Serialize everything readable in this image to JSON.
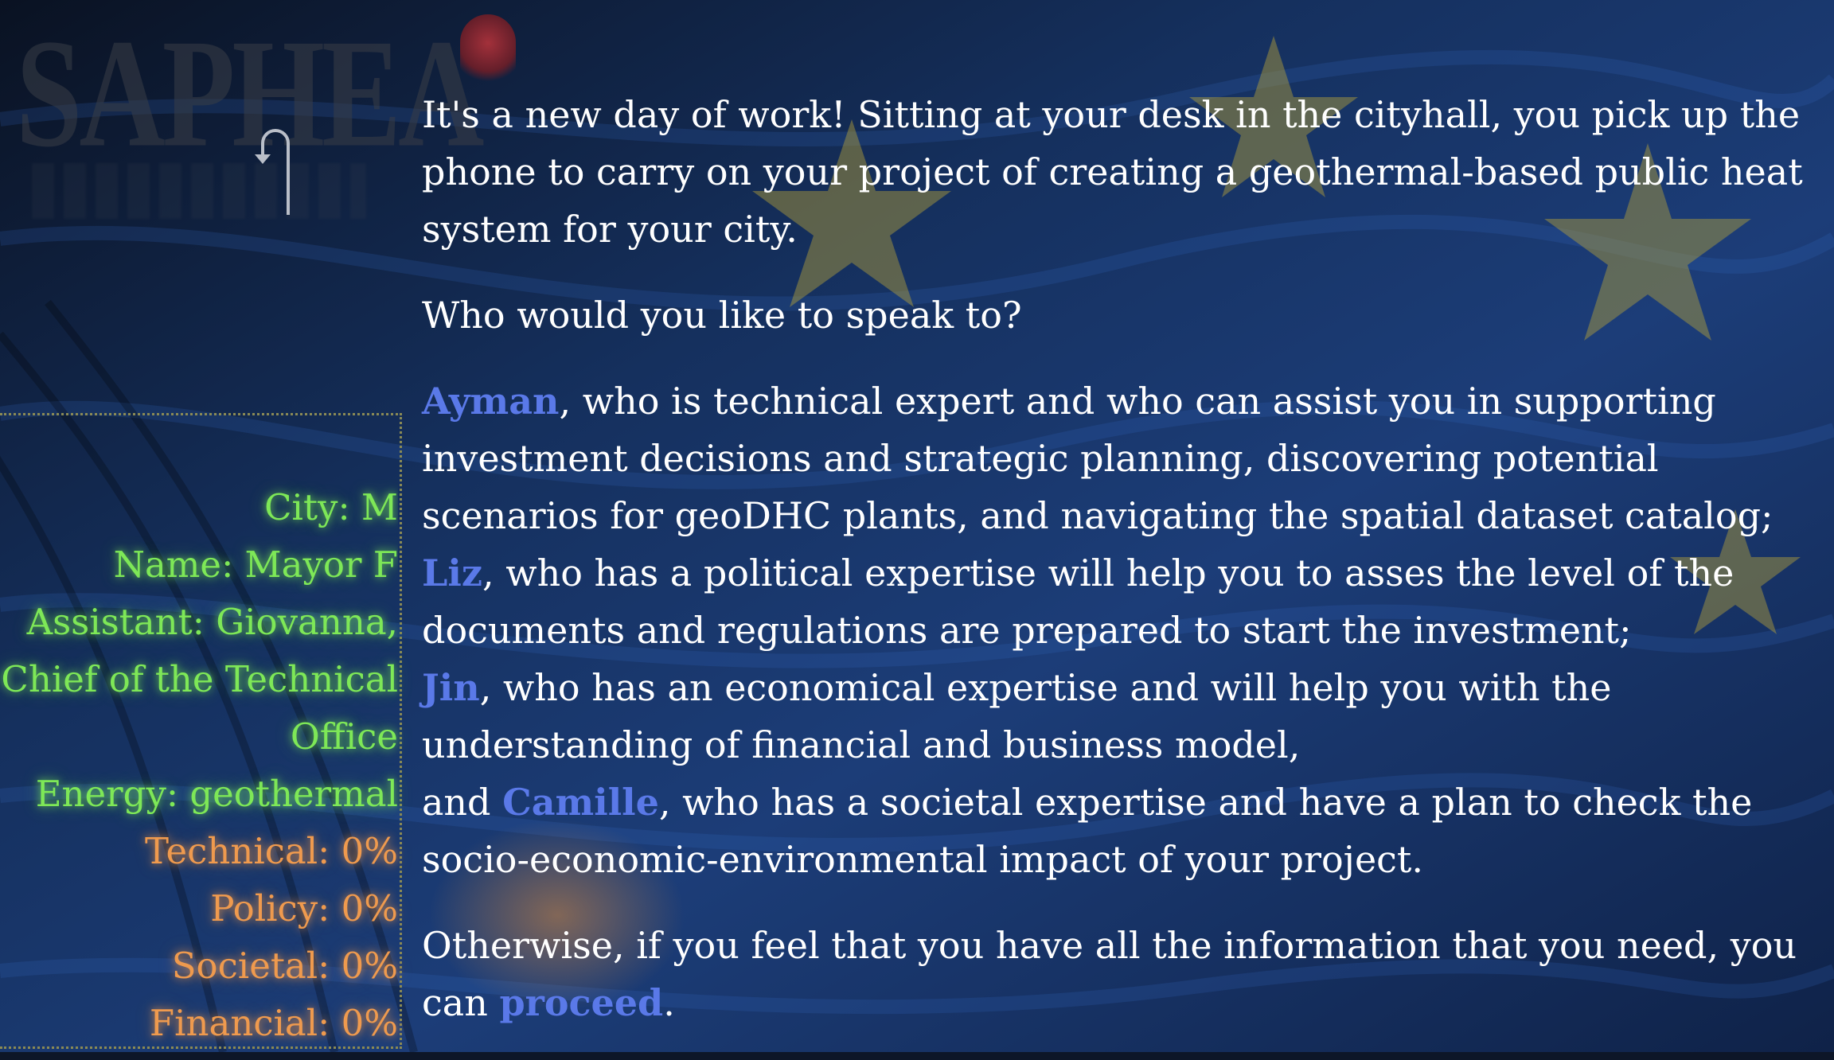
{
  "logo": {
    "text": "SAPHEA"
  },
  "profile": {
    "city": "City: M",
    "name": "Name: Mayor F",
    "assistant": "Assistant: Giovanna, Chief of the Technical Office",
    "energy": "Energy: geothermal",
    "technical": "Technical: 0%",
    "policy": "Policy: 0%",
    "societal": "Societal: 0%",
    "financial": "Financial: 0%"
  },
  "story": {
    "intro": "It's a new day of work! Sitting at your desk in the cityhall, you pick up the phone to carry on your project of creating a geothermal-based public heat system for your city.",
    "question": "Who would you like to speak to?",
    "ayman": {
      "link": "Ayman",
      "text": ", who is technical expert and who can assist you in supporting investment decisions and strategic planning, discovering potential scenarios for geoDHC plants, and navigating the spatial dataset catalog;"
    },
    "liz": {
      "link": "Liz",
      "text": ", who has a political expertise will help you to asses the level of the documents and regulations are prepared to start the investment;"
    },
    "jin": {
      "link": "Jin",
      "text": ", who has an economical expertise and will help you with the understanding of financial and business model,"
    },
    "camille": {
      "prefix": "and ",
      "link": "Camille",
      "text": ", who has a societal expertise and have a plan to check the socio-economic-environmental impact of your project."
    },
    "otherwise": {
      "text": "Otherwise, if you feel that you have all the information that you need, you can ",
      "link": "proceed",
      "suffix": "."
    }
  },
  "colors": {
    "link": "#5a79e8",
    "stat_green": "#7ee857",
    "stat_orange": "#ef9a4e",
    "background": "#0d1628"
  },
  "icons": {
    "back": "return-arrow-icon"
  }
}
